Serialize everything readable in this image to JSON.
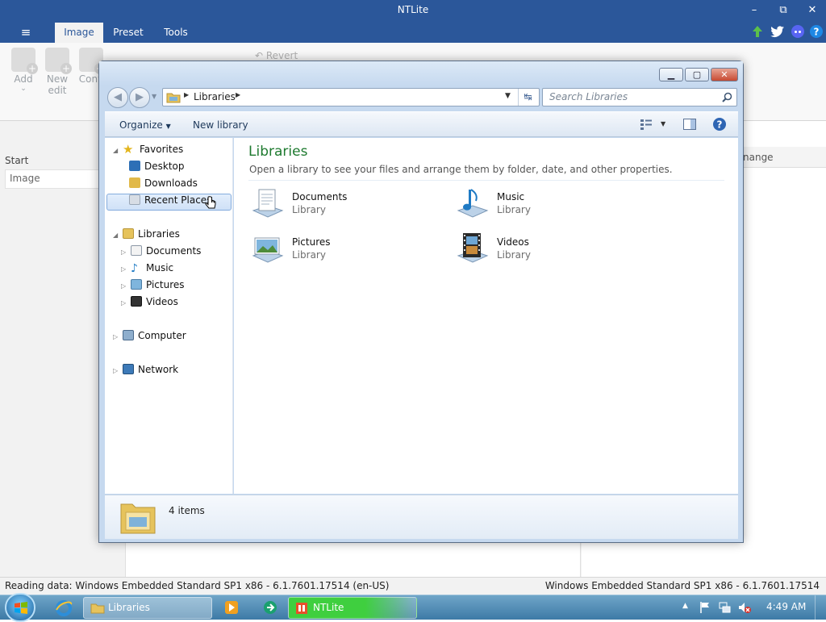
{
  "app": {
    "title": "NTLite",
    "window_controls": {
      "minimize": "–",
      "restore": "⧉",
      "close": "✕"
    },
    "header_icons": [
      "up-arrow-icon",
      "twitter-icon",
      "discord-icon",
      "help-icon"
    ],
    "menu_icon": "≡",
    "tabs": [
      {
        "label": "Image",
        "active": true
      },
      {
        "label": "Preset",
        "active": false
      },
      {
        "label": "Tools",
        "active": false
      }
    ],
    "ribbon": {
      "add_label": "Add",
      "new_edit_label_1": "New",
      "new_edit_label_2": "edit",
      "convert_label": "Conv",
      "revert_label": "Revert"
    },
    "left_panel": {
      "section_label": "Start",
      "item": "Image"
    },
    "right_panel": {
      "header_fragment": "nange"
    },
    "status": {
      "left": "Reading data: Windows Embedded Standard SP1 x86 - 6.1.7601.17514 (en-US)",
      "right": "Windows Embedded Standard SP1 x86 - 6.1.7601.17514"
    }
  },
  "explorer": {
    "address": {
      "crumb": "Libraries"
    },
    "search_placeholder": "Search Libraries",
    "toolbar": {
      "organize_label": "Organize",
      "new_library_label": "New library"
    },
    "nav": {
      "favorites": {
        "label": "Favorites",
        "items": [
          "Desktop",
          "Downloads",
          "Recent Places"
        ]
      },
      "libraries": {
        "label": "Libraries",
        "items": [
          "Documents",
          "Music",
          "Pictures",
          "Videos"
        ]
      },
      "computer": "Computer",
      "network": "Network"
    },
    "content": {
      "title": "Libraries",
      "subtitle": "Open a library to see your files and arrange them by folder, date, and other properties.",
      "libraries": [
        {
          "name": "Documents",
          "type": "Library",
          "icon": "documents-library-icon"
        },
        {
          "name": "Music",
          "type": "Library",
          "icon": "music-library-icon"
        },
        {
          "name": "Pictures",
          "type": "Library",
          "icon": "pictures-library-icon"
        },
        {
          "name": "Videos",
          "type": "Library",
          "icon": "videos-library-icon"
        }
      ]
    },
    "details": {
      "count": "4 items"
    }
  },
  "taskbar": {
    "buttons": [
      {
        "label": "Libraries",
        "icon": "folder-icon"
      },
      {
        "label": "NTLite",
        "icon": "ntlite-icon"
      }
    ],
    "clock": "4:49 AM",
    "accent": "#3fcf3f"
  }
}
